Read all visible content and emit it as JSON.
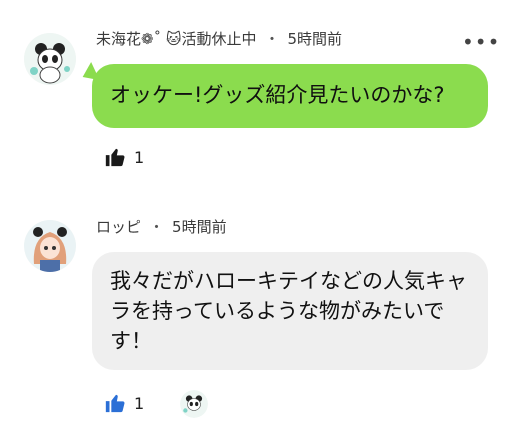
{
  "comments": [
    {
      "author": "未海花❁˚ 🐱活動休止中",
      "time": "5時間前",
      "body": "オッケー!グッズ紹介見たいのかな?",
      "likes": "1",
      "bubble_color": "#8bdc4e",
      "like_icon": "thumbs-up-icon",
      "liked": false
    },
    {
      "author": "ロッピ",
      "time": "5時間前",
      "body": "我々だがハローキテイなどの人気キャラを持っているような物がみたいです！",
      "likes": "1",
      "bubble_color": "#efefef",
      "like_icon": "thumbs-up-icon",
      "liked": true
    }
  ],
  "separator": "・",
  "more_label": "•••",
  "accent_like_color": "#2b6fd6"
}
